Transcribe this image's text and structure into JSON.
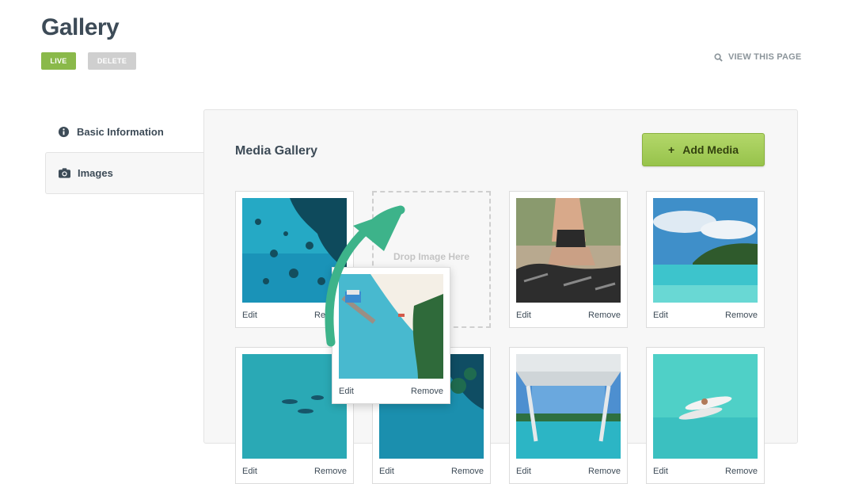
{
  "header": {
    "title": "Gallery",
    "live_label": "LIVE",
    "delete_label": "DELETE",
    "view_page_label": "VIEW THIS PAGE"
  },
  "sidebar": {
    "items": [
      {
        "label": "Basic Information",
        "icon": "info-circle-icon"
      },
      {
        "label": "Images",
        "icon": "camera-icon",
        "active": true
      }
    ]
  },
  "media": {
    "title": "Media Gallery",
    "add_label": "Add Media",
    "add_icon": "+",
    "drop_label": "Drop Image Here",
    "cards": [
      {
        "edit": "Edit",
        "remove": "Remove",
        "image": "aerial-reef"
      },
      {
        "edit": "Edit",
        "remove": "Remove",
        "image": "yoga-meditation"
      },
      {
        "edit": "Edit",
        "remove": "Remove",
        "image": "tropical-island"
      },
      {
        "edit": "Edit",
        "remove": "Remove",
        "image": "swimmers"
      },
      {
        "edit": "Edit",
        "remove": "Remove",
        "image": "reef-aerial"
      },
      {
        "edit": "Edit",
        "remove": "Remove",
        "image": "boat-view"
      },
      {
        "edit": "Edit",
        "remove": "Remove",
        "image": "paddleboards"
      }
    ],
    "dragged": {
      "edit": "Edit",
      "remove": "Remove",
      "image": "beach-pier"
    }
  },
  "colors": {
    "live": "#8ab94a",
    "delete": "#cfcfcf",
    "add_button": "#a6cf5a",
    "arrow": "#3db38a"
  }
}
